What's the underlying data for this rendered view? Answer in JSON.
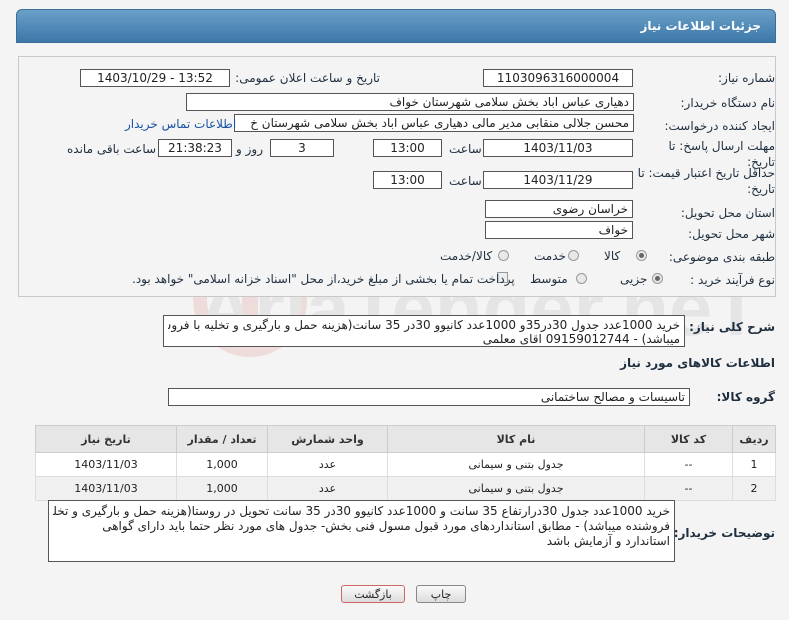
{
  "header": {
    "title": "جزئیات اطلاعات نیاز"
  },
  "form": {
    "need_number_label": "شماره نیاز:",
    "need_number": "1103096316000004",
    "announce_label": "تاریخ و ساعت اعلان عمومی:",
    "announce_value": "1403/10/29 - 13:52",
    "buyer_org_label": "نام دستگاه خریدار:",
    "buyer_org": "دهیاری عباس اباد بخش سلامی شهرستان خواف",
    "requester_label": "ایجاد کننده درخواست:",
    "requester": "محسن جلالی منقابی مدیر مالی دهیاری عباس اباد بخش سلامی شهرستان خ",
    "contact_link": "اطلاعات تماس خریدار",
    "deadline_label_1": "مهلت ارسال پاسخ: تا",
    "deadline_label_2": "تاریخ:",
    "deadline_date": "1403/11/03",
    "time_label": "ساعت",
    "deadline_time": "13:00",
    "days_value": "3",
    "days_label": "روز و",
    "remaining_time": "21:38:23",
    "remaining_label": "ساعت باقی مانده",
    "validity_label_1": "حداقل تاریخ اعتبار قیمت: تا",
    "validity_label_2": "تاریخ:",
    "validity_date": "1403/11/29",
    "validity_time": "13:00",
    "province_label": "استان محل تحویل:",
    "province": "خراسان رضوی",
    "city_label": "شهر محل تحویل:",
    "city": "خواف",
    "category_label": "طبقه بندی موضوعی:",
    "category_options": [
      "کالا",
      "خدمت",
      "کالا/خدمت"
    ],
    "purchase_type_label": "نوع فرآیند خرید :",
    "purchase_options": [
      "جزیی",
      "متوسط"
    ],
    "payment_text": "پرداخت تمام یا بخشی از مبلغ خرید،از محل \"اسناد خزانه اسلامی\" خواهد بود."
  },
  "summary": {
    "label": "شرح کلی نیاز:",
    "text_line1": "خرید 1000عدد جدول 30در35و 1000عدد کانیوو 30در 35 سانت(هزینه حمل و بارگیری و تخلیه با فروشنده",
    "text_line2": "میباشد) - 09159012744 اقای معلمی"
  },
  "goods": {
    "section_title": "اطلاعات کالاهای مورد نیاز",
    "group_label": "گروه کالا:",
    "group_value": "تاسیسات و مصالح ساختمانی",
    "columns": [
      "ردیف",
      "کد کالا",
      "نام کالا",
      "واحد شمارش",
      "تعداد / مقدار",
      "تاریخ نیاز"
    ],
    "rows": [
      {
        "row": "1",
        "code": "--",
        "name": "جدول بتنی و سیمانی",
        "unit": "عدد",
        "qty": "1,000",
        "date": "1403/11/03"
      },
      {
        "row": "2",
        "code": "--",
        "name": "جدول بتنی و سیمانی",
        "unit": "عدد",
        "qty": "1,000",
        "date": "1403/11/03"
      }
    ]
  },
  "notes": {
    "label": "توضیحات خریدار:",
    "line1": "خرید 1000عدد جدول 30درارتفاع 35 سانت و 1000عدد کانیوو 30در 35 سانت تحویل در روستا(هزینه حمل و بارگیری و تخلیه با",
    "line2": "فروشنده  میباشد) - مطابق استانداردهای مورد قبول مسول فنی بخش- جدول های مورد نظر حتما باید دارای گواهی",
    "line3": "استاندارد و آزمایش باشد"
  },
  "buttons": {
    "print": "چاپ",
    "back": "بازگشت"
  },
  "watermark": {
    "text": "AriaTender.neT"
  }
}
